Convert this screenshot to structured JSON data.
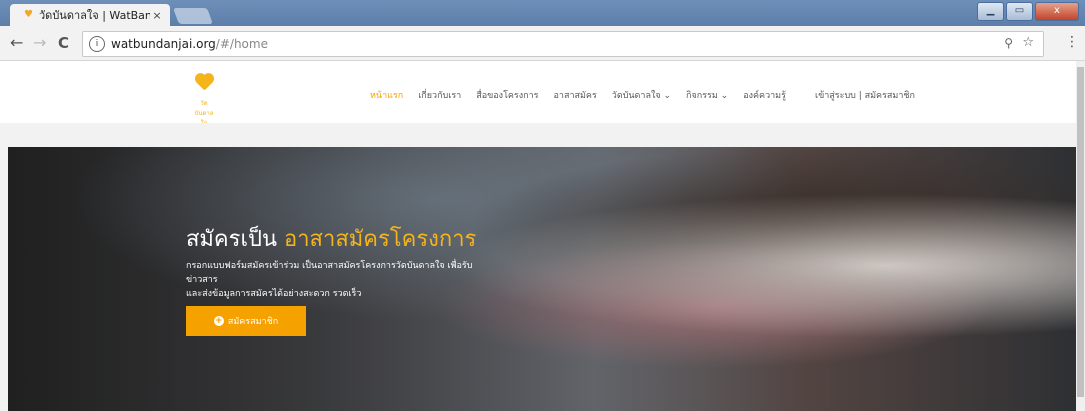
{
  "browser": {
    "tab_title": "วัดบันดาลใจ | WatBandanj",
    "tab_close": "×",
    "url_host": "watbundanjai.org",
    "url_path": "/#/home",
    "zoom_glyph": "⚲",
    "star_glyph": "☆",
    "menu_glyph": "⋮",
    "back_glyph": "←",
    "forward_glyph": "→",
    "reload_glyph": "C",
    "info_glyph": "i",
    "window_buttons": [
      "▁",
      "▭",
      "x"
    ]
  },
  "site": {
    "logo_caption": "วัดบันดาลใจ",
    "nav": [
      "หน้าแรก",
      "เกี่ยวกับเรา",
      "สื่อของโครงการ",
      "อาสาสมัคร",
      "วัดบันดาลใจ ⌄",
      "กิจกรรม ⌄",
      "องค์ความรู้"
    ],
    "member_link": "เข้าสู่ระบบ | สมัครสมาชิก"
  },
  "hero": {
    "headline_prefix": "สมัครเป็น ",
    "headline_highlight": "อาสาสมัครโครงการ",
    "description_line1": "กรอกแบบฟอร์มสมัครเข้าร่วม เป็นอาสาสมัครโครงการวัดบันดาลใจ เพื่อรับข่าวสาร",
    "description_line2": "และส่งข้อมูลการสมัครได้อย่างสะดวก รวดเร็ว",
    "cta_label": "สมัครสมาชิก",
    "cta_icon": "+"
  },
  "colors": {
    "accent": "#f5a100",
    "logo": "#f5b41a"
  }
}
